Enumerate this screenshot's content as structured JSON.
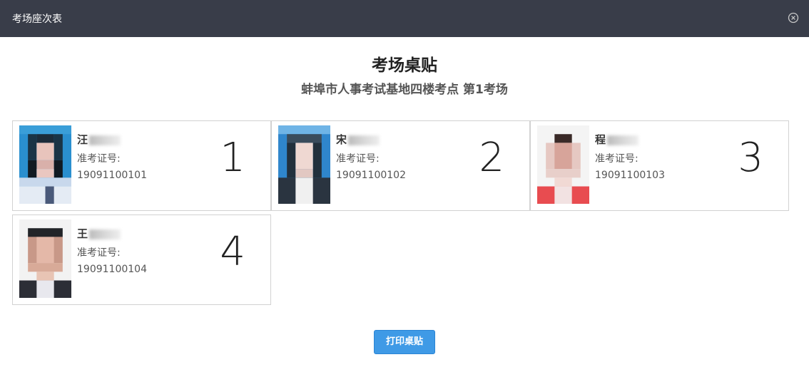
{
  "window": {
    "title": "考场座次表",
    "close_icon": "close-circle-icon"
  },
  "header": {
    "title": "考场桌贴",
    "subtitle": "蚌埠市人事考试基地四楼考点 第1考场"
  },
  "cards": [
    {
      "name": "汪",
      "ticket_label": "准考证号:",
      "ticket_no": "19091100101",
      "seat": "1"
    },
    {
      "name": "宋",
      "ticket_label": "准考证号:",
      "ticket_no": "19091100102",
      "seat": "2"
    },
    {
      "name": "程",
      "ticket_label": "准考证号:",
      "ticket_no": "19091100103",
      "seat": "3"
    },
    {
      "name": "王",
      "ticket_label": "准考证号:",
      "ticket_no": "19091100104",
      "seat": "4"
    }
  ],
  "actions": {
    "print_label": "打印桌贴"
  },
  "colors": {
    "titlebar": "#393d49",
    "primary_button": "#3f9ae6"
  }
}
